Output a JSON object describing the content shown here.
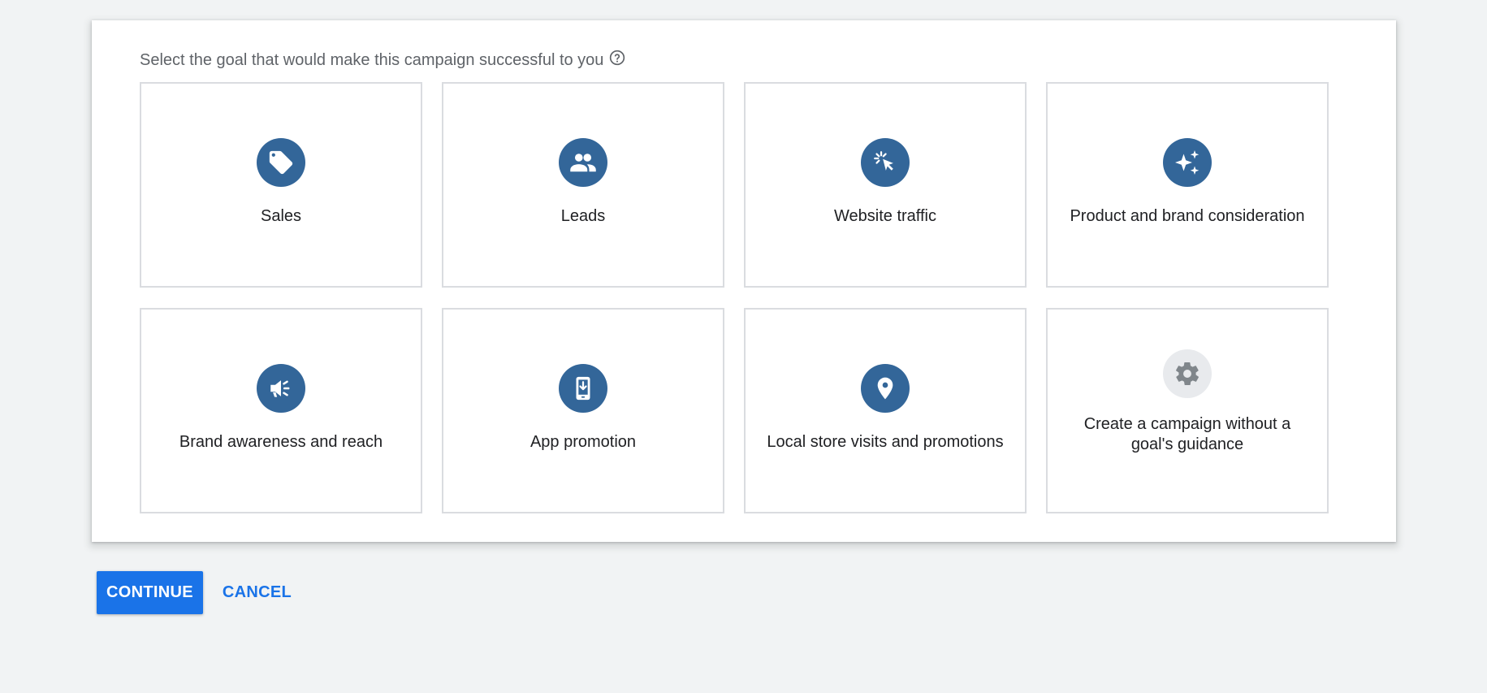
{
  "prompt": {
    "text": "Select the goal that would make this campaign successful to you",
    "help_icon": "help-circle-icon"
  },
  "goals": [
    {
      "label": "Sales",
      "icon": "tag-icon"
    },
    {
      "label": "Leads",
      "icon": "people-icon"
    },
    {
      "label": "Website traffic",
      "icon": "cursor-click-icon"
    },
    {
      "label": "Product and brand consideration",
      "icon": "sparkle-icon"
    },
    {
      "label": "Brand awareness and reach",
      "icon": "megaphone-icon"
    },
    {
      "label": "App promotion",
      "icon": "phone-download-icon"
    },
    {
      "label": "Local store visits and promotions",
      "icon": "location-pin-icon"
    },
    {
      "label": "Create a campaign without a goal's guidance",
      "icon": "gear-icon"
    }
  ],
  "actions": {
    "continue_label": "CONTINUE",
    "cancel_label": "CANCEL"
  },
  "colors": {
    "icon_bg": "#336699",
    "icon_bg_disabled": "#e8eaed",
    "primary": "#1a73e8",
    "background": "#f1f3f4"
  }
}
